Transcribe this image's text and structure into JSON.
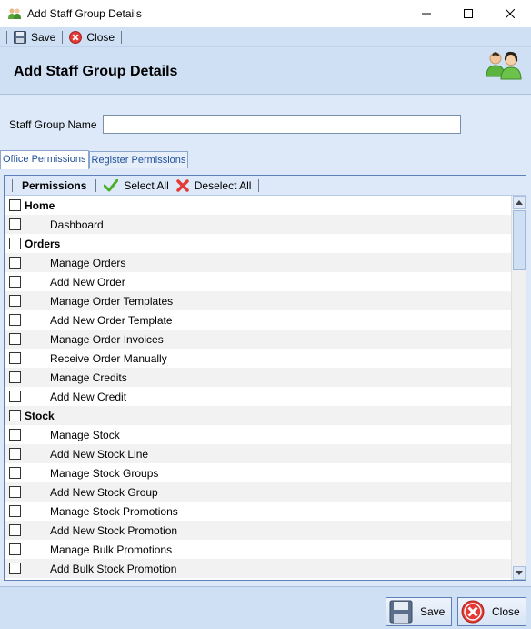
{
  "window": {
    "title": "Add Staff Group Details"
  },
  "toolbar": {
    "save_label": "Save",
    "close_label": "Close"
  },
  "header": {
    "title": "Add Staff Group Details"
  },
  "form": {
    "staff_group_name_label": "Staff Group Name",
    "staff_group_name_value": ""
  },
  "tabs": [
    {
      "label": "Office Permissions",
      "active": true
    },
    {
      "label": "Register Permissions",
      "active": false
    }
  ],
  "permissions_bar": {
    "title": "Permissions",
    "select_all": "Select All",
    "deselect_all": "Deselect All"
  },
  "permissions": [
    {
      "label": "Home",
      "group": true
    },
    {
      "label": "Dashboard",
      "group": false
    },
    {
      "label": "Orders",
      "group": true
    },
    {
      "label": "Manage Orders",
      "group": false
    },
    {
      "label": "Add New Order",
      "group": false
    },
    {
      "label": "Manage Order Templates",
      "group": false
    },
    {
      "label": "Add New Order Template",
      "group": false
    },
    {
      "label": "Manage Order Invoices",
      "group": false
    },
    {
      "label": "Receive Order Manually",
      "group": false
    },
    {
      "label": "Manage Credits",
      "group": false
    },
    {
      "label": "Add New Credit",
      "group": false
    },
    {
      "label": "Stock",
      "group": true
    },
    {
      "label": "Manage Stock",
      "group": false
    },
    {
      "label": "Add New Stock Line",
      "group": false
    },
    {
      "label": "Manage Stock Groups",
      "group": false
    },
    {
      "label": "Add New Stock Group",
      "group": false
    },
    {
      "label": "Manage Stock Promotions",
      "group": false
    },
    {
      "label": "Add New Stock Promotion",
      "group": false
    },
    {
      "label": "Manage Bulk Promotions",
      "group": false
    },
    {
      "label": "Add Bulk Stock Promotion",
      "group": false
    }
  ],
  "footer": {
    "save_label": "Save",
    "close_label": "Close"
  },
  "colors": {
    "accent": "#cfe0f5",
    "panel_border": "#5d80b8",
    "tab_text": "#1f4f9a"
  }
}
